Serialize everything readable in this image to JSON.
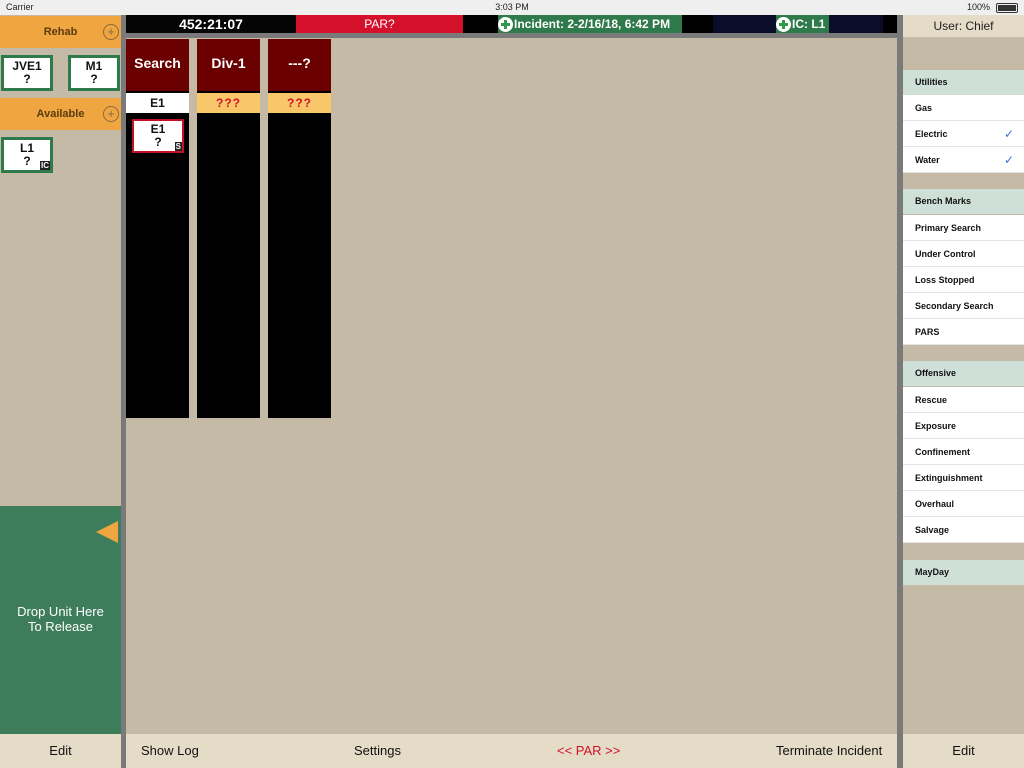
{
  "status_bar": {
    "carrier": "Carrier",
    "time": "3:03 PM",
    "battery": "100%"
  },
  "header": {
    "clock": "452:21:07",
    "par": "PAR?",
    "incident": "Incident: 2-2/16/18, 6:42 PM",
    "ic": "IC: L1"
  },
  "left_panel": {
    "rehab": {
      "label": "Rehab",
      "plus": "+"
    },
    "rehab_units": [
      {
        "name": "JVE1",
        "status": "?"
      },
      {
        "name": "M1",
        "status": "?"
      }
    ],
    "available": {
      "label": "Available",
      "plus": "+"
    },
    "available_units": [
      {
        "name": "L1",
        "status": "?",
        "tag": "IC"
      }
    ],
    "drop_zone": {
      "line1": "Drop Unit Here",
      "line2": "To Release"
    },
    "edit": "Edit"
  },
  "board": {
    "columns": [
      {
        "title": "Search",
        "sub": "E1",
        "sub_style": "white",
        "unit": {
          "name": "E1",
          "status": "?",
          "tag": "S"
        }
      },
      {
        "title": "Div-1",
        "sub": "???",
        "sub_style": "yellow"
      },
      {
        "title": "---?",
        "sub": "???",
        "sub_style": "yellow"
      }
    ]
  },
  "bottom_bar": {
    "show_log": "Show Log",
    "settings": "Settings",
    "par": "<< PAR >>",
    "terminate": "Terminate Incident"
  },
  "right_panel": {
    "user": "User: Chief",
    "utilities": {
      "label": "Utilities",
      "items": [
        {
          "label": "Gas",
          "checked": false
        },
        {
          "label": "Electric",
          "checked": true
        },
        {
          "label": "Water",
          "checked": true
        }
      ]
    },
    "benchmarks": {
      "label": "Bench Marks",
      "items": [
        "Primary Search",
        "Under Control",
        "Loss Stopped",
        "Secondary Search",
        "PARS"
      ]
    },
    "offensive": {
      "label": "Offensive",
      "items": [
        "Rescue",
        "Exposure",
        "Confinement",
        "Extinguishment",
        "Overhaul",
        "Salvage"
      ]
    },
    "mayday": "MayDay",
    "edit": "Edit",
    "check_glyph": "✓"
  },
  "colors": {
    "accent_orange": "#f0a640",
    "board_bg": "#c5baa5",
    "unit_green": "#2f7a4a",
    "header_red": "#6b0000",
    "par_red": "#d4102a"
  }
}
